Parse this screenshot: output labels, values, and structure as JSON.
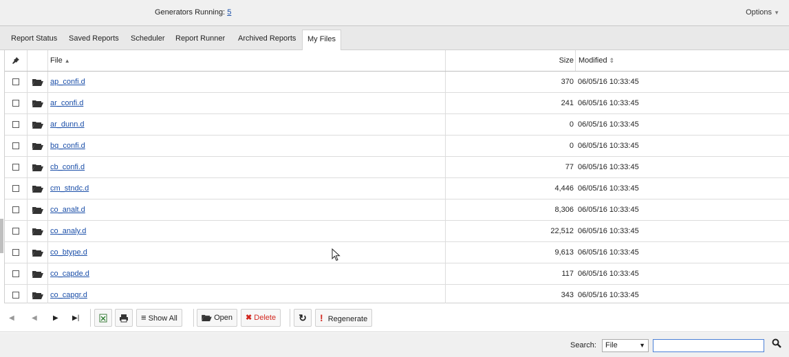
{
  "header": {
    "generators_label": "Generators Running:",
    "generators_count": "5",
    "options_label": "Options"
  },
  "tabs": [
    {
      "label": "Report Status"
    },
    {
      "label": "Saved Reports"
    },
    {
      "label": "Scheduler"
    },
    {
      "label": "Report Runner"
    },
    {
      "label": "Archived Reports"
    },
    {
      "label": "My Files",
      "active": true
    }
  ],
  "grid": {
    "columns": {
      "file": "File",
      "size": "Size",
      "modified": "Modified"
    },
    "rows": [
      {
        "file": "ap_confi.d",
        "size": "370",
        "modified": "06/05/16 10:33:45"
      },
      {
        "file": "ar_confi.d",
        "size": "241",
        "modified": "06/05/16 10:33:45"
      },
      {
        "file": "ar_dunn.d",
        "size": "0",
        "modified": "06/05/16 10:33:45"
      },
      {
        "file": "bq_confi.d",
        "size": "0",
        "modified": "06/05/16 10:33:45"
      },
      {
        "file": "cb_confi.d",
        "size": "77",
        "modified": "06/05/16 10:33:45"
      },
      {
        "file": "cm_stndc.d",
        "size": "4,446",
        "modified": "06/05/16 10:33:45"
      },
      {
        "file": "co_analt.d",
        "size": "8,306",
        "modified": "06/05/16 10:33:45"
      },
      {
        "file": "co_analy.d",
        "size": "22,512",
        "modified": "06/05/16 10:33:45"
      },
      {
        "file": "co_btype.d",
        "size": "9,613",
        "modified": "06/05/16 10:33:45"
      },
      {
        "file": "co_capde.d",
        "size": "117",
        "modified": "06/05/16 10:33:45"
      },
      {
        "file": "co_capgr.d",
        "size": "343",
        "modified": "06/05/16 10:33:45"
      }
    ]
  },
  "toolbar": {
    "show_all": "Show All",
    "open": "Open",
    "delete": "Delete",
    "regenerate": "Regenerate"
  },
  "footer": {
    "search_label": "Search:",
    "search_field": "File",
    "search_value": ""
  },
  "colors": {
    "link": "#1a4ea8",
    "delete": "#d2261e",
    "regenerate": "#d2261e"
  }
}
